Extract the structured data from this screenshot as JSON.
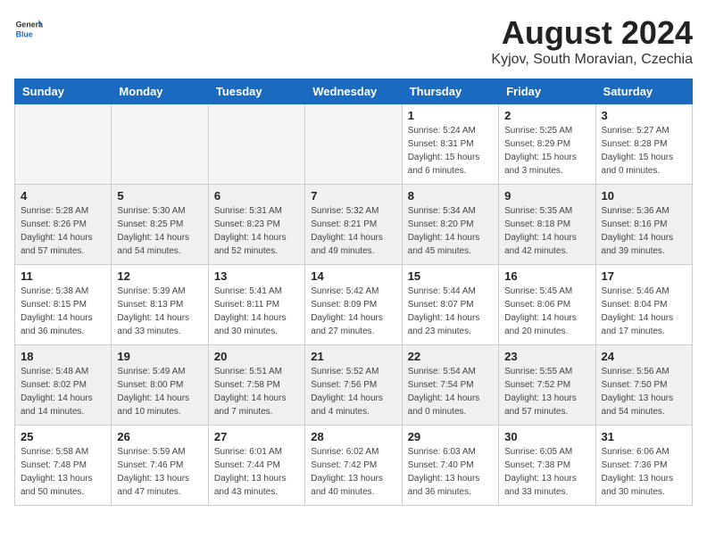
{
  "header": {
    "logo_general": "General",
    "logo_blue": "Blue",
    "month_year": "August 2024",
    "location": "Kyjov, South Moravian, Czechia"
  },
  "days_of_week": [
    "Sunday",
    "Monday",
    "Tuesday",
    "Wednesday",
    "Thursday",
    "Friday",
    "Saturday"
  ],
  "weeks": [
    [
      {
        "day": "",
        "detail": "",
        "empty": true
      },
      {
        "day": "",
        "detail": "",
        "empty": true
      },
      {
        "day": "",
        "detail": "",
        "empty": true
      },
      {
        "day": "",
        "detail": "",
        "empty": true
      },
      {
        "day": "1",
        "detail": "Sunrise: 5:24 AM\nSunset: 8:31 PM\nDaylight: 15 hours\nand 6 minutes."
      },
      {
        "day": "2",
        "detail": "Sunrise: 5:25 AM\nSunset: 8:29 PM\nDaylight: 15 hours\nand 3 minutes."
      },
      {
        "day": "3",
        "detail": "Sunrise: 5:27 AM\nSunset: 8:28 PM\nDaylight: 15 hours\nand 0 minutes."
      }
    ],
    [
      {
        "day": "4",
        "detail": "Sunrise: 5:28 AM\nSunset: 8:26 PM\nDaylight: 14 hours\nand 57 minutes.",
        "gray": true
      },
      {
        "day": "5",
        "detail": "Sunrise: 5:30 AM\nSunset: 8:25 PM\nDaylight: 14 hours\nand 54 minutes.",
        "gray": true
      },
      {
        "day": "6",
        "detail": "Sunrise: 5:31 AM\nSunset: 8:23 PM\nDaylight: 14 hours\nand 52 minutes.",
        "gray": true
      },
      {
        "day": "7",
        "detail": "Sunrise: 5:32 AM\nSunset: 8:21 PM\nDaylight: 14 hours\nand 49 minutes.",
        "gray": true
      },
      {
        "day": "8",
        "detail": "Sunrise: 5:34 AM\nSunset: 8:20 PM\nDaylight: 14 hours\nand 45 minutes.",
        "gray": true
      },
      {
        "day": "9",
        "detail": "Sunrise: 5:35 AM\nSunset: 8:18 PM\nDaylight: 14 hours\nand 42 minutes.",
        "gray": true
      },
      {
        "day": "10",
        "detail": "Sunrise: 5:36 AM\nSunset: 8:16 PM\nDaylight: 14 hours\nand 39 minutes.",
        "gray": true
      }
    ],
    [
      {
        "day": "11",
        "detail": "Sunrise: 5:38 AM\nSunset: 8:15 PM\nDaylight: 14 hours\nand 36 minutes."
      },
      {
        "day": "12",
        "detail": "Sunrise: 5:39 AM\nSunset: 8:13 PM\nDaylight: 14 hours\nand 33 minutes."
      },
      {
        "day": "13",
        "detail": "Sunrise: 5:41 AM\nSunset: 8:11 PM\nDaylight: 14 hours\nand 30 minutes."
      },
      {
        "day": "14",
        "detail": "Sunrise: 5:42 AM\nSunset: 8:09 PM\nDaylight: 14 hours\nand 27 minutes."
      },
      {
        "day": "15",
        "detail": "Sunrise: 5:44 AM\nSunset: 8:07 PM\nDaylight: 14 hours\nand 23 minutes."
      },
      {
        "day": "16",
        "detail": "Sunrise: 5:45 AM\nSunset: 8:06 PM\nDaylight: 14 hours\nand 20 minutes."
      },
      {
        "day": "17",
        "detail": "Sunrise: 5:46 AM\nSunset: 8:04 PM\nDaylight: 14 hours\nand 17 minutes."
      }
    ],
    [
      {
        "day": "18",
        "detail": "Sunrise: 5:48 AM\nSunset: 8:02 PM\nDaylight: 14 hours\nand 14 minutes.",
        "gray": true
      },
      {
        "day": "19",
        "detail": "Sunrise: 5:49 AM\nSunset: 8:00 PM\nDaylight: 14 hours\nand 10 minutes.",
        "gray": true
      },
      {
        "day": "20",
        "detail": "Sunrise: 5:51 AM\nSunset: 7:58 PM\nDaylight: 14 hours\nand 7 minutes.",
        "gray": true
      },
      {
        "day": "21",
        "detail": "Sunrise: 5:52 AM\nSunset: 7:56 PM\nDaylight: 14 hours\nand 4 minutes.",
        "gray": true
      },
      {
        "day": "22",
        "detail": "Sunrise: 5:54 AM\nSunset: 7:54 PM\nDaylight: 14 hours\nand 0 minutes.",
        "gray": true
      },
      {
        "day": "23",
        "detail": "Sunrise: 5:55 AM\nSunset: 7:52 PM\nDaylight: 13 hours\nand 57 minutes.",
        "gray": true
      },
      {
        "day": "24",
        "detail": "Sunrise: 5:56 AM\nSunset: 7:50 PM\nDaylight: 13 hours\nand 54 minutes.",
        "gray": true
      }
    ],
    [
      {
        "day": "25",
        "detail": "Sunrise: 5:58 AM\nSunset: 7:48 PM\nDaylight: 13 hours\nand 50 minutes."
      },
      {
        "day": "26",
        "detail": "Sunrise: 5:59 AM\nSunset: 7:46 PM\nDaylight: 13 hours\nand 47 minutes."
      },
      {
        "day": "27",
        "detail": "Sunrise: 6:01 AM\nSunset: 7:44 PM\nDaylight: 13 hours\nand 43 minutes."
      },
      {
        "day": "28",
        "detail": "Sunrise: 6:02 AM\nSunset: 7:42 PM\nDaylight: 13 hours\nand 40 minutes."
      },
      {
        "day": "29",
        "detail": "Sunrise: 6:03 AM\nSunset: 7:40 PM\nDaylight: 13 hours\nand 36 minutes."
      },
      {
        "day": "30",
        "detail": "Sunrise: 6:05 AM\nSunset: 7:38 PM\nDaylight: 13 hours\nand 33 minutes."
      },
      {
        "day": "31",
        "detail": "Sunrise: 6:06 AM\nSunset: 7:36 PM\nDaylight: 13 hours\nand 30 minutes."
      }
    ]
  ]
}
